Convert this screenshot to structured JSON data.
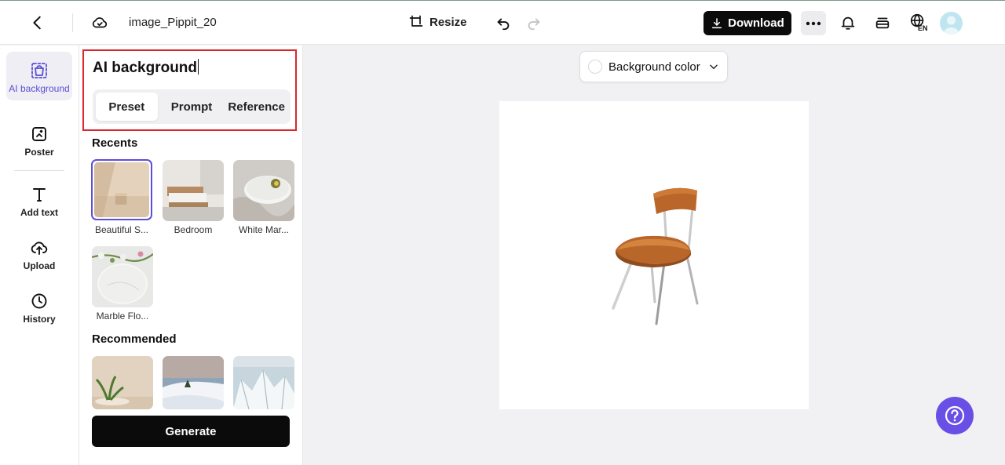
{
  "topbar": {
    "filename": "image_Pippit_20",
    "resize_label": "Resize",
    "download_label": "Download",
    "language": "EN"
  },
  "rail": {
    "items": [
      {
        "label": "AI background"
      },
      {
        "label": "Poster"
      },
      {
        "label": "Add text"
      },
      {
        "label": "Upload"
      },
      {
        "label": "History"
      }
    ]
  },
  "panel": {
    "title": "AI background",
    "tabs": [
      {
        "label": "Preset",
        "active": true
      },
      {
        "label": "Prompt",
        "active": false
      },
      {
        "label": "Reference",
        "active": false
      }
    ],
    "recents_title": "Recents",
    "recents": [
      {
        "label": "Beautiful S..."
      },
      {
        "label": "Bedroom"
      },
      {
        "label": "White Mar..."
      },
      {
        "label": "Marble Flo..."
      }
    ],
    "recommended_title": "Recommended",
    "generate_label": "Generate"
  },
  "canvas": {
    "bg_color_label": "Background color"
  },
  "colors": {
    "accent": "#5b4fd6",
    "highlight_border": "#d9272e",
    "help_button": "#6a4fe6"
  }
}
